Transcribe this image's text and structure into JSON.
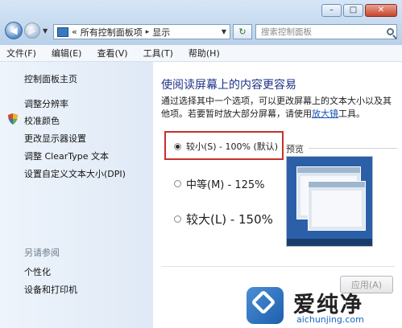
{
  "window": {
    "controls": {
      "minimize": "–",
      "maximize": "□",
      "close": "✕"
    }
  },
  "navigation": {
    "address": {
      "root_chevron": "«",
      "crumb_1": "所有控制面板项",
      "separator": "▸",
      "crumb_2": "显示"
    },
    "search_placeholder": "搜索控制面板"
  },
  "menubar": [
    "文件(F)",
    "编辑(E)",
    "查看(V)",
    "工具(T)",
    "帮助(H)"
  ],
  "sidebar": {
    "items": [
      "控制面板主页",
      "调整分辨率",
      "校准颜色",
      "更改显示器设置",
      "调整 ClearType 文本",
      "设置自定义文本大小(DPI)"
    ],
    "see_also_title": "另请参阅",
    "see_also": [
      "个性化",
      "设备和打印机"
    ]
  },
  "main": {
    "heading": "使阅读屏幕上的内容更容易",
    "description_prefix": "通过选择其中一个选项，可以更改屏幕上的文本大小以及其他项。若要暂时放大部分屏幕，请使用",
    "description_link": "放大镜",
    "description_suffix": "工具。",
    "options": [
      {
        "label": "较小(S) - 100% (默认)",
        "selected": true
      },
      {
        "label": "中等(M) - 125%",
        "selected": false
      },
      {
        "label": "较大(L) - 150%",
        "selected": false
      }
    ],
    "preview_label": "预览",
    "apply_button": "应用(A)"
  },
  "watermark": {
    "brand": "爱纯净",
    "url": "aichunjing.com"
  },
  "colors": {
    "heading": "#1e3287",
    "highlight_border": "#c8302c",
    "link": "#1a55b8",
    "preview_desktop": "#2b5fa8"
  }
}
